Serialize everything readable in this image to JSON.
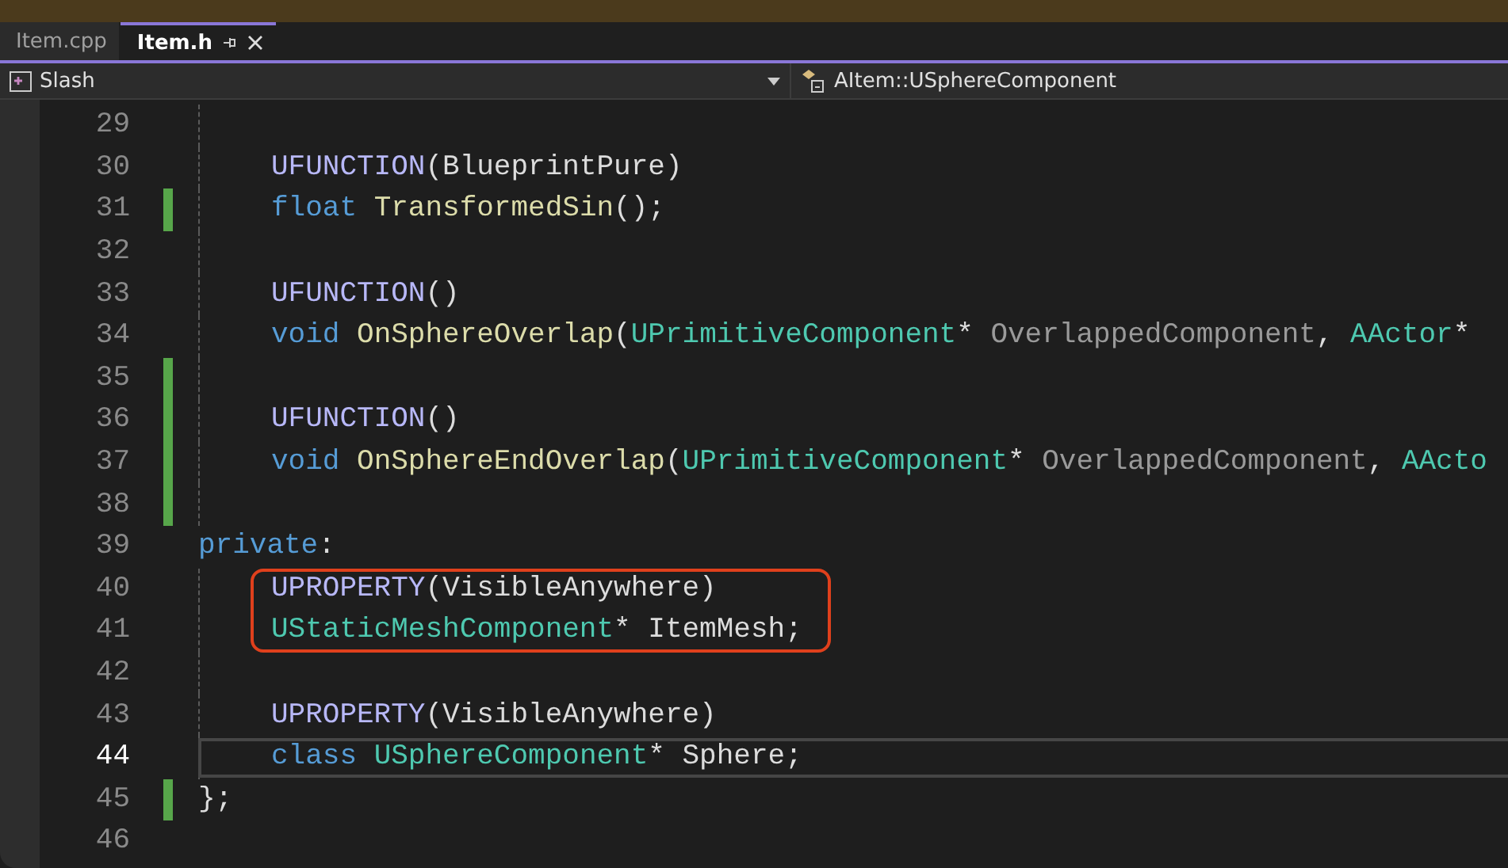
{
  "tabs": [
    {
      "label": "Item.cpp",
      "selected": false
    },
    {
      "label": "Item.h",
      "selected": true
    }
  ],
  "navigation": {
    "project": "Slash",
    "member": "AItem::USphereComponent"
  },
  "lines": [
    {
      "number": "29",
      "indented": true,
      "changed": false,
      "current": false,
      "boxed": false
    },
    {
      "number": "30",
      "indented": true,
      "changed": false,
      "current": false,
      "boxed": false,
      "tokens": [
        {
          "kind": "macro",
          "text": "UFUNCTION"
        },
        {
          "kind": "plain",
          "text": "(BlueprintPure)"
        }
      ]
    },
    {
      "number": "31",
      "indented": true,
      "changed": true,
      "current": false,
      "boxed": false,
      "tokens": [
        {
          "kind": "keyword",
          "text": "float"
        },
        {
          "kind": "function",
          "text": " TransformedSin"
        },
        {
          "kind": "plain",
          "text": "();"
        }
      ]
    },
    {
      "number": "32",
      "indented": true,
      "changed": false,
      "current": false,
      "boxed": false
    },
    {
      "number": "33",
      "indented": true,
      "changed": false,
      "current": false,
      "boxed": false,
      "tokens": [
        {
          "kind": "macro",
          "text": "UFUNCTION"
        },
        {
          "kind": "plain",
          "text": "()"
        }
      ]
    },
    {
      "number": "34",
      "indented": true,
      "changed": false,
      "current": false,
      "boxed": false,
      "tokens": [
        {
          "kind": "keyword",
          "text": "void"
        },
        {
          "kind": "function",
          "text": " OnSphereOverlap"
        },
        {
          "kind": "plain",
          "text": "("
        },
        {
          "kind": "type",
          "text": "UPrimitiveComponent"
        },
        {
          "kind": "plain",
          "text": "* "
        },
        {
          "kind": "parameter",
          "text": "OverlappedComponent"
        },
        {
          "kind": "plain",
          "text": ", "
        },
        {
          "kind": "type",
          "text": "AActor"
        },
        {
          "kind": "plain",
          "text": "*"
        }
      ]
    },
    {
      "number": "35",
      "indented": true,
      "changed": true,
      "current": false,
      "boxed": false
    },
    {
      "number": "36",
      "indented": true,
      "changed": true,
      "current": false,
      "boxed": false,
      "tokens": [
        {
          "kind": "macro",
          "text": "UFUNCTION"
        },
        {
          "kind": "plain",
          "text": "()"
        }
      ]
    },
    {
      "number": "37",
      "indented": true,
      "changed": true,
      "current": false,
      "boxed": false,
      "tokens": [
        {
          "kind": "keyword",
          "text": "void"
        },
        {
          "kind": "function",
          "text": " OnSphereEndOverlap"
        },
        {
          "kind": "plain",
          "text": "("
        },
        {
          "kind": "type",
          "text": "UPrimitiveComponent"
        },
        {
          "kind": "plain",
          "text": "* "
        },
        {
          "kind": "parameter",
          "text": "OverlappedComponent"
        },
        {
          "kind": "plain",
          "text": ", "
        },
        {
          "kind": "type",
          "text": "AActo"
        }
      ]
    },
    {
      "number": "38",
      "indented": true,
      "changed": true,
      "current": false,
      "boxed": false
    },
    {
      "number": "39",
      "indented": false,
      "changed": false,
      "current": false,
      "boxed": false,
      "tokens": [
        {
          "kind": "keyword",
          "text": "private"
        },
        {
          "kind": "plain",
          "text": ":"
        }
      ]
    },
    {
      "number": "40",
      "indented": true,
      "changed": false,
      "current": false,
      "boxed": true,
      "tokens": [
        {
          "kind": "macro",
          "text": "UPROPERTY"
        },
        {
          "kind": "plain",
          "text": "(VisibleAnywhere)"
        }
      ]
    },
    {
      "number": "41",
      "indented": true,
      "changed": false,
      "current": false,
      "boxed": true,
      "tokens": [
        {
          "kind": "type",
          "text": "UStaticMeshComponent"
        },
        {
          "kind": "plain",
          "text": "* ItemMesh;"
        }
      ]
    },
    {
      "number": "42",
      "indented": true,
      "changed": false,
      "current": false,
      "boxed": false
    },
    {
      "number": "43",
      "indented": true,
      "changed": false,
      "current": false,
      "boxed": false,
      "tokens": [
        {
          "kind": "macro",
          "text": "UPROPERTY"
        },
        {
          "kind": "plain",
          "text": "(VisibleAnywhere)"
        }
      ]
    },
    {
      "number": "44",
      "indented": true,
      "changed": false,
      "current": true,
      "boxed": false,
      "tokens": [
        {
          "kind": "keyword",
          "text": "class"
        },
        {
          "kind": "type",
          "text": " USphereComponent"
        },
        {
          "kind": "plain",
          "text": "* Sphere;"
        }
      ]
    },
    {
      "number": "45",
      "indented": false,
      "changed": true,
      "current": false,
      "boxed": false,
      "tokens": [
        {
          "kind": "plain",
          "text": "};"
        }
      ]
    },
    {
      "number": "46",
      "indented": false,
      "changed": false,
      "current": false,
      "boxed": false
    }
  ]
}
